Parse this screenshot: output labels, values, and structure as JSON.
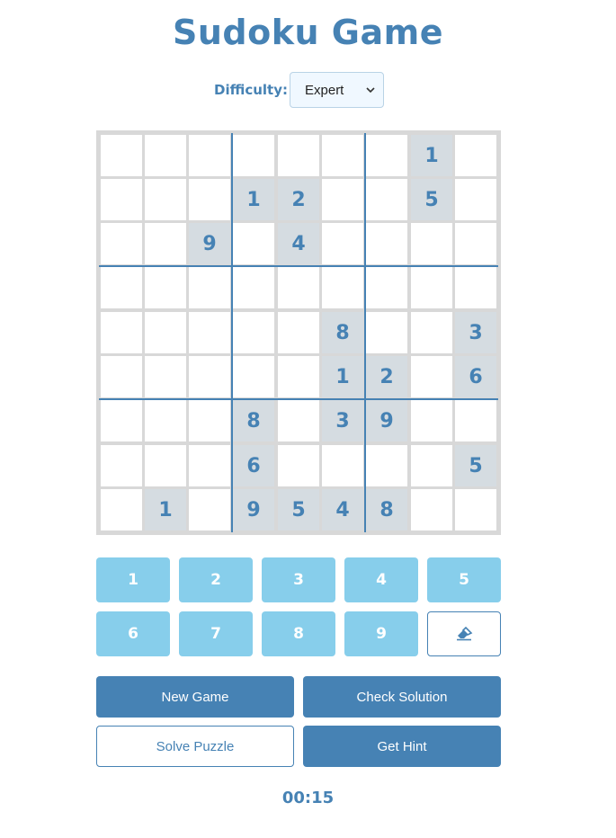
{
  "title": "Sudoku Game",
  "difficulty": {
    "label": "Difficulty:",
    "selected": "Expert"
  },
  "board": [
    [
      "",
      "",
      "",
      "",
      "",
      "",
      "",
      "1",
      ""
    ],
    [
      "",
      "",
      "",
      "1",
      "2",
      "",
      "",
      "5",
      ""
    ],
    [
      "",
      "",
      "9",
      "",
      "4",
      "",
      "",
      "",
      ""
    ],
    [
      "",
      "",
      "",
      "",
      "",
      "",
      "",
      "",
      ""
    ],
    [
      "",
      "",
      "",
      "",
      "",
      "8",
      "",
      "",
      "3"
    ],
    [
      "",
      "",
      "",
      "",
      "",
      "1",
      "2",
      "",
      "6"
    ],
    [
      "",
      "",
      "",
      "8",
      "",
      "3",
      "9",
      "",
      ""
    ],
    [
      "",
      "",
      "",
      "6",
      "",
      "",
      "",
      "",
      "5"
    ],
    [
      "",
      "1",
      "",
      "9",
      "5",
      "4",
      "8",
      "",
      ""
    ]
  ],
  "numpad": [
    "1",
    "2",
    "3",
    "4",
    "5",
    "6",
    "7",
    "8",
    "9"
  ],
  "erase_icon": "eraser-icon",
  "actions": {
    "new_game": "New Game",
    "check_solution": "Check Solution",
    "solve_puzzle": "Solve Puzzle",
    "get_hint": "Get Hint"
  },
  "timer": "00:15",
  "colors": {
    "accent": "#4682b4",
    "numpad": "#87ceeb",
    "given_cell": "#d5dce1",
    "grid_line": "#d8d8d8"
  }
}
